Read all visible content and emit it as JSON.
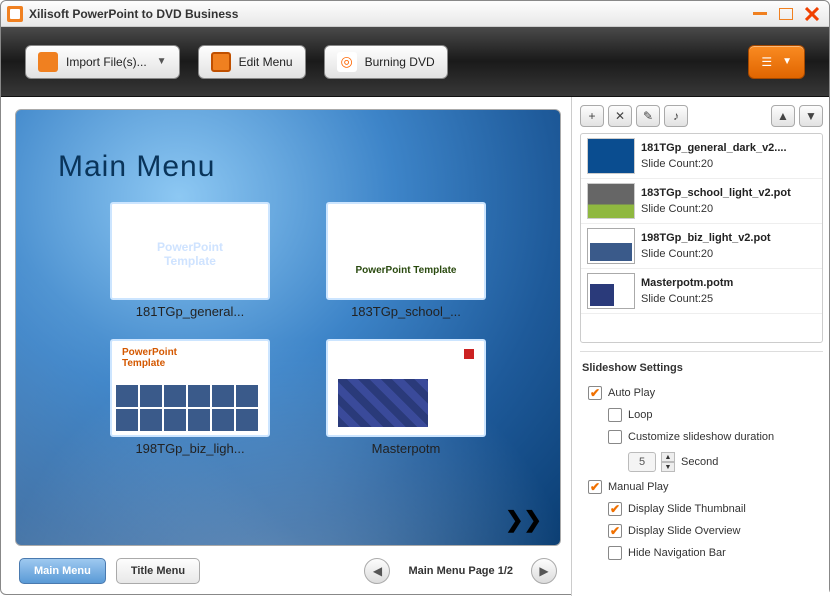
{
  "title": "Xilisoft PowerPoint to DVD Business",
  "toolbar": {
    "import": "Import File(s)...",
    "edit": "Edit Menu",
    "burn": "Burning DVD"
  },
  "stage": {
    "heading": "Main Menu",
    "thumbs": [
      {
        "caption": "181TGp_general..."
      },
      {
        "caption": "183TGp_school_..."
      },
      {
        "caption": "198TGp_biz_ligh..."
      },
      {
        "caption": "Masterpotm"
      }
    ]
  },
  "menu_footer": {
    "main": "Main Menu",
    "title": "Title Menu",
    "page": "Main Menu Page 1/2"
  },
  "files": [
    {
      "name": "181TGp_general_dark_v2....",
      "count": "Slide Count:20"
    },
    {
      "name": "183TGp_school_light_v2.pot",
      "count": "Slide Count:20"
    },
    {
      "name": "198TGp_biz_light_v2.pot",
      "count": "Slide Count:20"
    },
    {
      "name": "Masterpotm.potm",
      "count": "Slide Count:25"
    }
  ],
  "settings": {
    "header": "Slideshow Settings",
    "auto_play": "Auto Play",
    "loop": "Loop",
    "customize": "Customize slideshow duration",
    "duration_value": "5",
    "duration_unit": "Second",
    "manual_play": "Manual Play",
    "display_thumb": "Display Slide Thumbnail",
    "display_overview": "Display Slide Overview",
    "hide_nav": "Hide Navigation Bar"
  }
}
